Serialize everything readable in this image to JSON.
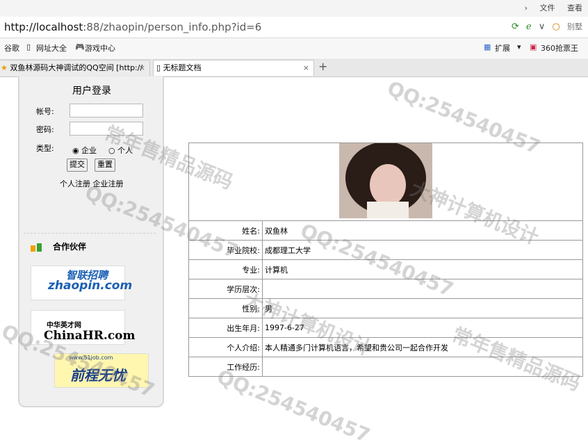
{
  "top_menu": [
    "文件",
    "查看"
  ],
  "address": {
    "host": "http://localhost",
    "rest": ":88/zhaopin/person_info.php?id=6",
    "right_label": "别墅"
  },
  "bookmarks": [
    "谷歌",
    "网址大全",
    "游戏中心"
  ],
  "bookmarks_right": [
    "扩展",
    "360抢票王"
  ],
  "tabs": [
    {
      "label": "双鱼林源码大神调试的QQ空间 [http://"
    },
    {
      "label": "无标题文档"
    }
  ],
  "login": {
    "title": "用户登录",
    "account_label": "帐号:",
    "password_label": "密码:",
    "type_label": "类型:",
    "type_options": [
      "企业",
      "个人"
    ],
    "submit": "提交",
    "reset": "重置",
    "links": [
      "个人注册",
      "企业注册"
    ]
  },
  "partners": {
    "title": "合作伙伴",
    "logos": [
      "zhaopin.com",
      "ChinaHR.com",
      "前程无忧"
    ],
    "zhaopin_cn": "智联招聘",
    "chinahr_cn": "中华英才网",
    "job51_url": "www.51job.com"
  },
  "person": {
    "rows": [
      {
        "label": "姓名:",
        "value": "双鱼林"
      },
      {
        "label": "毕业院校:",
        "value": "成都理工大学"
      },
      {
        "label": "专业:",
        "value": "计算机"
      },
      {
        "label": "学历层次:",
        "value": ""
      },
      {
        "label": "性别:",
        "value": "男"
      },
      {
        "label": "出生年月:",
        "value": "1997-6-27"
      },
      {
        "label": "个人介绍:",
        "value": "本人精通多门计算机语言，希望和贵公司一起合作开发"
      },
      {
        "label": "工作经历:",
        "value": ""
      }
    ]
  },
  "watermarks": [
    "QQ:254540457",
    "常年售精品源码",
    "大神计算机设计"
  ]
}
